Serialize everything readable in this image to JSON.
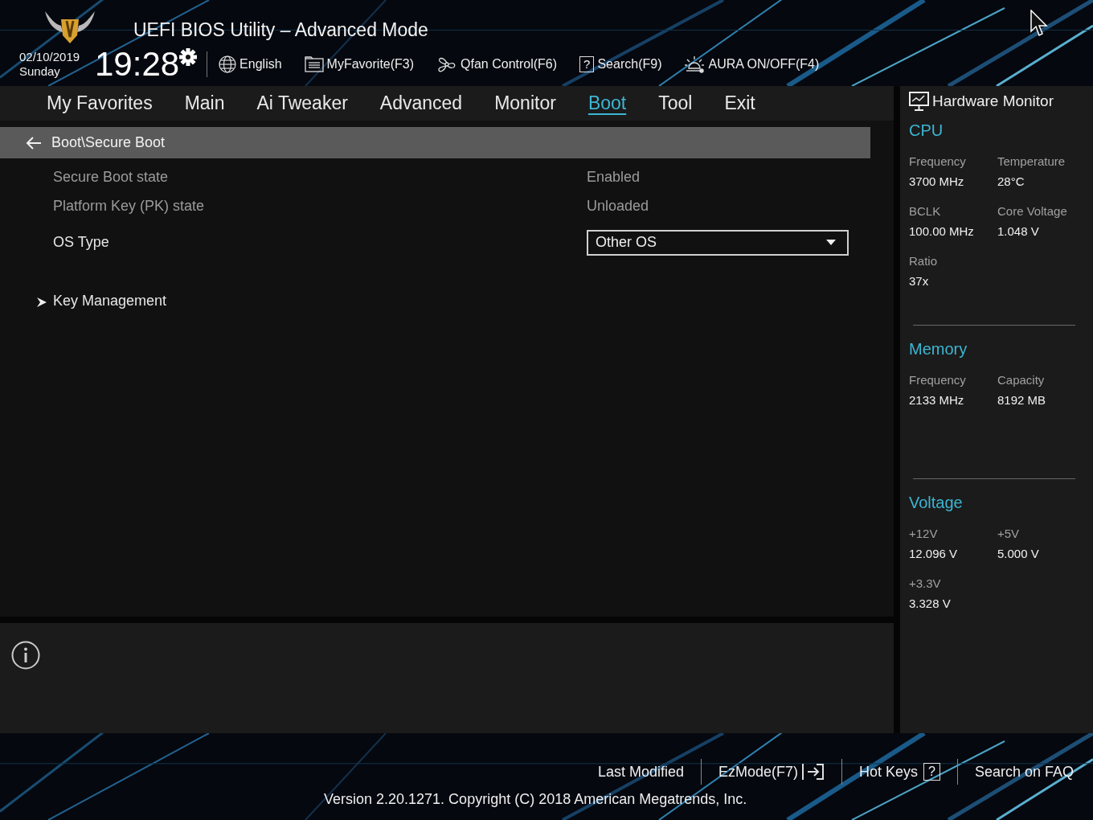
{
  "header": {
    "title": "UEFI BIOS Utility – Advanced Mode",
    "date": "02/10/2019",
    "day": "Sunday",
    "time": "19:28",
    "tools": [
      {
        "kind": "language",
        "label": "English"
      },
      {
        "kind": "favorite",
        "label": "MyFavorite(F3)"
      },
      {
        "kind": "qfan",
        "label": "Qfan Control(F6)"
      },
      {
        "kind": "search",
        "icon": "?",
        "label": "Search(F9)"
      },
      {
        "kind": "aura",
        "label": "AURA ON/OFF(F4)"
      }
    ]
  },
  "tabs": [
    {
      "label": "My Favorites",
      "selected": false
    },
    {
      "label": "Main",
      "selected": false
    },
    {
      "label": "Ai Tweaker",
      "selected": false
    },
    {
      "label": "Advanced",
      "selected": false
    },
    {
      "label": "Monitor",
      "selected": false
    },
    {
      "label": "Boot",
      "selected": true
    },
    {
      "label": "Tool",
      "selected": false
    },
    {
      "label": "Exit",
      "selected": false
    }
  ],
  "breadcrumb": "Boot\\Secure Boot",
  "settings": [
    {
      "kind": "info",
      "label": "Secure Boot state",
      "value": "Enabled"
    },
    {
      "kind": "info",
      "label": "Platform Key (PK) state",
      "value": "Unloaded"
    },
    {
      "kind": "dropdown",
      "label": "OS Type",
      "value": "Other OS"
    },
    {
      "kind": "submenu",
      "label": "Key Management"
    }
  ],
  "hardware_monitor": {
    "title": "Hardware Monitor",
    "sections": [
      {
        "title": "CPU",
        "items": [
          {
            "label": "Frequency",
            "value": "3700 MHz"
          },
          {
            "label": "Temperature",
            "value": "28°C"
          },
          {
            "label": "BCLK",
            "value": "100.00 MHz"
          },
          {
            "label": "Core Voltage",
            "value": "1.048 V"
          },
          {
            "label": "Ratio",
            "value": "37x"
          }
        ]
      },
      {
        "title": "Memory",
        "items": [
          {
            "label": "Frequency",
            "value": "2133 MHz"
          },
          {
            "label": "Capacity",
            "value": "8192 MB"
          }
        ]
      },
      {
        "title": "Voltage",
        "items": [
          {
            "label": "+12V",
            "value": "12.096 V"
          },
          {
            "label": "+5V",
            "value": "5.000 V"
          },
          {
            "label": "+3.3V",
            "value": "3.328 V"
          }
        ]
      }
    ]
  },
  "footer": {
    "links": [
      {
        "kind": "text",
        "label": "Last Modified"
      },
      {
        "kind": "ezmode",
        "label": "EzMode(F7)"
      },
      {
        "kind": "hotkeys",
        "label": "Hot Keys",
        "icon": "?"
      },
      {
        "kind": "text",
        "label": "Search on FAQ"
      }
    ],
    "version": "Version 2.20.1271. Copyright (C) 2018 American Megatrends, Inc."
  }
}
